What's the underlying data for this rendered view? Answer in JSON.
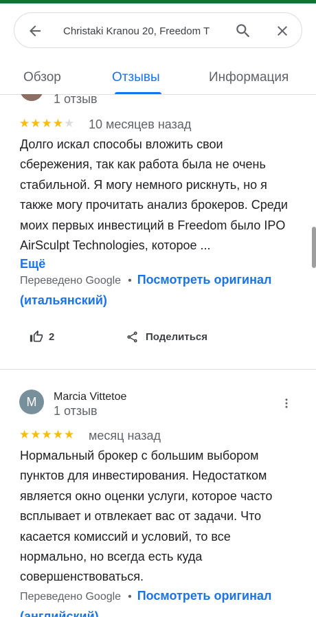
{
  "search": {
    "query": "Christaki Kranou 20, Freedom T",
    "back_icon": "arrow-left-icon",
    "search_icon": "search-icon",
    "close_icon": "close-icon"
  },
  "tabs": [
    {
      "label": "Обзор",
      "active": false
    },
    {
      "label": "Отзывы",
      "active": true
    },
    {
      "label": "Информация",
      "active": false
    }
  ],
  "reviews": [
    {
      "reviewer_count": "1 отзыв",
      "rating": 4,
      "date": "10 месяцев назад",
      "text": "Долго искал способы вложить свои сбережения, так как работа была не очень стабильной. Я могу немного рискнуть, но я также могу прочитать анализ брокеров. Среди моих первых инвестиций в Freedom было IPO AirSculpt Technologies, которое ...",
      "more_label": "Ещё",
      "translated_label": "Переведено Google",
      "original_link": "Посмотреть оригинал (итальянский)",
      "likes": "2",
      "share_label": "Поделиться"
    },
    {
      "avatar_letter": "M",
      "author": "Marcia Vittetoe",
      "reviewer_count": "1 отзыв",
      "rating": 5,
      "date": "месяц назад",
      "text": "Нормальный брокер с большим выбором пунктов для инвестирования. Недостатком является окно оценки услуги, которое часто всплывает и отвлекает вас от задачи. Что касается комиссий и условий, то все нормально, но всегда есть куда совершенствоваться.",
      "translated_label": "Переведено Google",
      "original_link": "Посмотреть оригинал (английский)"
    }
  ],
  "colors": {
    "accent": "#1a73e8",
    "star": "#fbbc04",
    "top_bar": "#137333"
  }
}
